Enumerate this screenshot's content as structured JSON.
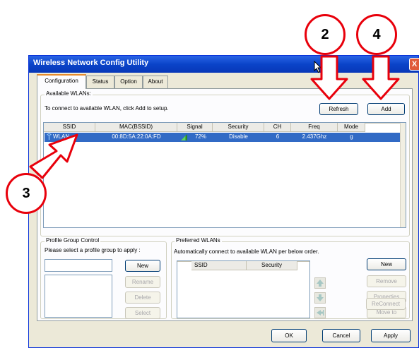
{
  "window": {
    "title": "Wireless Network Config Utility",
    "close_glyph": "X"
  },
  "tabs": [
    {
      "label": "Configuration",
      "active": true
    },
    {
      "label": "Status"
    },
    {
      "label": "Option"
    },
    {
      "label": "About"
    }
  ],
  "available": {
    "group_title": "Available WLANs:",
    "hint": "To connect to available WLAN, click Add to setup.",
    "refresh_label": "Refresh",
    "add_label": "Add",
    "columns": [
      "SSID",
      "MAC(BSSID)",
      "Signal",
      "Security",
      "CH",
      "Freq",
      "Mode"
    ],
    "rows": [
      {
        "ssid": "WLAN",
        "mac": "00:8D:5A:22:0A:FD",
        "signal": "72%",
        "signal_level": 0.72,
        "security": "Disable",
        "ch": "6",
        "freq": "2.437Ghz",
        "mode": "g",
        "selected": true
      }
    ]
  },
  "profile_group": {
    "title": "Profile Group Control",
    "hint": "Please select a profile group to apply :",
    "name_value": "",
    "new_label": "New",
    "rename_label": "Rename",
    "delete_label": "Delete",
    "select_label": "Select"
  },
  "preferred": {
    "title": "Preferred WLANs",
    "hint": "Automatically connect to available WLAN per below order.",
    "columns": [
      "SSID",
      "Security"
    ],
    "new_label": "New",
    "remove_label": "Remove",
    "properties_label": "Properties",
    "moveto_label": "Move to",
    "reconnect_label": "ReConnect"
  },
  "footer": {
    "ok_label": "OK",
    "cancel_label": "Cancel",
    "apply_label": "Apply"
  },
  "callouts": {
    "refresh_num": "2",
    "select_num": "3",
    "add_num": "4"
  },
  "colors": {
    "callout_red": "#e8000b",
    "selection_blue": "#316ac5",
    "title_blue": "#0a44c9"
  },
  "icons": {
    "up": "arrow-up-icon",
    "down": "arrow-down-icon",
    "moveto": "move-to-icon"
  }
}
